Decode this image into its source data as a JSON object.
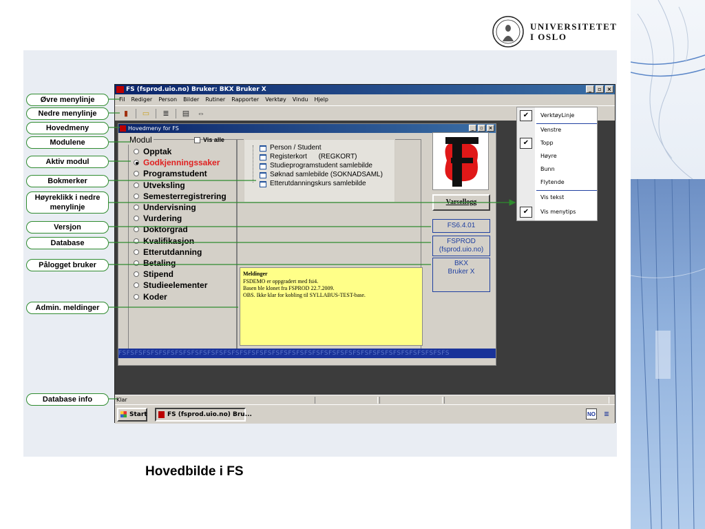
{
  "logo": {
    "line1": "UNIVERSITETET",
    "line2": "I OSLO"
  },
  "app": {
    "title": "FS (fsprod.uio.no) Bruker: BKX Bruker X",
    "menu": [
      "Fil",
      "Rediger",
      "Person",
      "Bilder",
      "Rutiner",
      "Rapporter",
      "Verktøy",
      "Vindu",
      "Hjelp"
    ],
    "statusbar": "Klar"
  },
  "hovedmeny": {
    "title": "Hovedmeny for FS",
    "modul_label": "Modul",
    "vis_alle": "Vis alle",
    "moduler": [
      "Opptak",
      "Godkjenningssaker",
      "Programstudent",
      "Utveksling",
      "Semesterregistrering",
      "Undervisning",
      "Vurdering",
      "Doktorgrad",
      "Kvalifikasjon",
      "Etterutdanning",
      "Betaling",
      "Stipend",
      "Studieelementer",
      "Koder"
    ],
    "aktiv_index": 1,
    "bokmerker": [
      "Person / Student",
      "Registerkort      (REGKORT)",
      "Studieprogramstudent samlebilde",
      "Søknad samlebilde (SOKNADSAML)",
      "Etterutdanningskurs samlebilde"
    ],
    "meldinger": {
      "title": "Meldinger",
      "lines": [
        "FSDEMO er oppgradert med fsi4.",
        "Basen ble klonet fra FSPROD  22.7.2009.",
        "OBS. Ikke klar for kobling til SYLLABUS-TEST-base."
      ]
    },
    "varsellogg": "Varsellogg",
    "versjon": "FS6.4.01",
    "database_line1": "FSPROD",
    "database_line2": "(fsprod.uio.no)",
    "bruker_line1": "BKX",
    "bruker_line2": "Bruker X",
    "fs_strip": "FSFSFSFSFSFSFSFSFSFSFSFSFSFSFSFSFSFSFSFSFSFSFSFSFSFSFSFSFSFSFSFSFSFSFSFSFSFSFSFSFS"
  },
  "taskbar": {
    "start": "Start",
    "task": "FS (fsprod.uio.no) Bru...",
    "lang": "NO"
  },
  "context_menu": {
    "items": [
      {
        "label": "VerktøyLinje",
        "checked": true
      },
      {
        "label": "Venstre",
        "checked": false
      },
      {
        "label": "Topp",
        "checked": true
      },
      {
        "label": "Høyre",
        "checked": false
      },
      {
        "label": "Bunn",
        "checked": false
      },
      {
        "label": "Flytende",
        "checked": false
      },
      {
        "label": "Vis tekst",
        "checked": false
      },
      {
        "label": "Vis menytips",
        "checked": true
      }
    ]
  },
  "callouts": {
    "ovre": "Øvre menylinje",
    "nedre": "Nedre menylinje",
    "hovedmeny": "Hovedmeny",
    "modulene": "Modulene",
    "aktiv": "Aktiv modul",
    "bokmerker": "Bokmerker",
    "hoyreklikk": "Høyreklikk i nedre menylinje",
    "versjon": "Versjon",
    "database": "Database",
    "palogget": "Pålogget bruker",
    "admin": "Admin. meldinger",
    "dbinfo": "Database info"
  },
  "caption": "Hovedbilde i FS",
  "colors": {
    "accent_green": "#2e8b2e",
    "active_module": "#e02020",
    "panel": "#e9edf3"
  }
}
